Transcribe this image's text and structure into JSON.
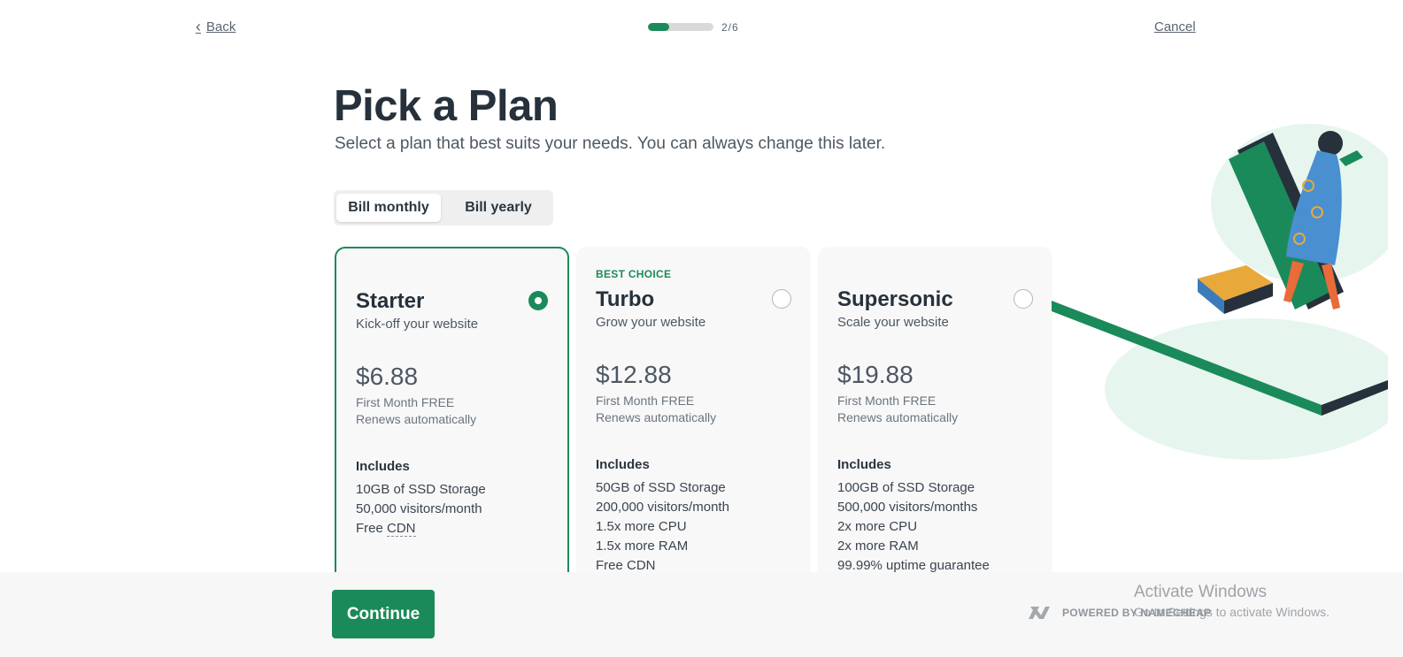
{
  "nav": {
    "back_label": "Back",
    "step_label": "2/6",
    "progress": 0.33,
    "cancel_label": "Cancel"
  },
  "header": {
    "title": "Pick a Plan",
    "subtitle": "Select a plan that best suits your needs. You can always change this later."
  },
  "billing": {
    "monthly_label": "Bill monthly",
    "yearly_label": "Bill yearly",
    "selected": "monthly"
  },
  "plans": [
    {
      "badge": "",
      "name": "Starter",
      "tagline": "Kick-off your website",
      "price": "$6.88",
      "promo": "First Month FREE",
      "renew": "Renews automatically",
      "includes_label": "Includes",
      "features": [
        "10GB of SSD Storage",
        "50,000 visitors/month",
        "Free CDN"
      ],
      "selected": true
    },
    {
      "badge": "BEST CHOICE",
      "name": "Turbo",
      "tagline": "Grow your website",
      "price": "$12.88",
      "promo": "First Month FREE",
      "renew": "Renews automatically",
      "includes_label": "Includes",
      "features": [
        "50GB of SSD Storage",
        "200,000 visitors/month",
        "1.5x more CPU",
        "1.5x more RAM",
        "Free CDN"
      ],
      "selected": false
    },
    {
      "badge": "",
      "name": "Supersonic",
      "tagline": "Scale your website",
      "price": "$19.88",
      "promo": "First Month FREE",
      "renew": "Renews automatically",
      "includes_label": "Includes",
      "features": [
        "100GB of SSD Storage",
        "500,000 visitors/months",
        "2x more CPU",
        "2x more RAM",
        "99.99% uptime guarantee"
      ],
      "selected": false
    }
  ],
  "footer": {
    "continue_label": "Continue",
    "powered_label": "POWERED BY NAMECHEAP"
  },
  "watermark": {
    "line1": "Activate Windows",
    "line2": "Go to Settings to activate Windows."
  },
  "colors": {
    "accent": "#1b8a5a",
    "text": "#26313c",
    "card_bg": "#f8f8f8"
  }
}
